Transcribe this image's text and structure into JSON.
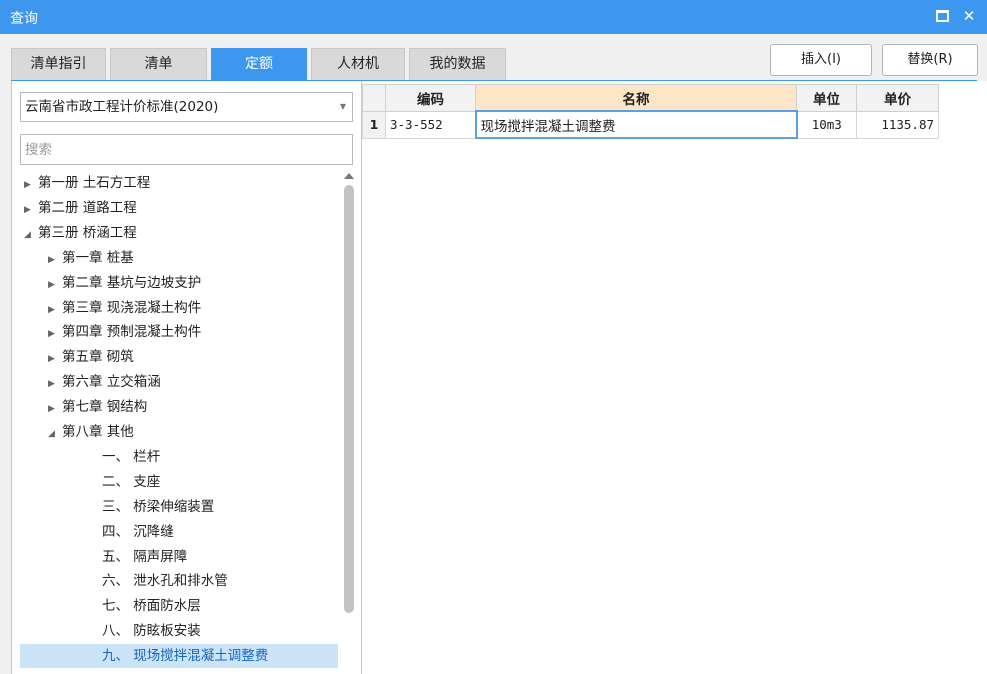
{
  "window": {
    "title": "查询"
  },
  "tabs": [
    "清单指引",
    "清单",
    "定额",
    "人材机",
    "我的数据"
  ],
  "active_tab": "定额",
  "buttons": {
    "insert": "插入(I)",
    "replace": "替换(R)"
  },
  "library_select": {
    "value": "云南省市政工程计价标准(2020)"
  },
  "search": {
    "placeholder": "搜索"
  },
  "tree": [
    {
      "label": "第一册 土石方工程",
      "state": "collapsed",
      "level": 0
    },
    {
      "label": "第二册 道路工程",
      "state": "collapsed",
      "level": 0
    },
    {
      "label": "第三册 桥涵工程",
      "state": "expanded",
      "level": 0
    },
    {
      "label": "第一章 桩基",
      "state": "collapsed",
      "level": 1
    },
    {
      "label": "第二章 基坑与边坡支护",
      "state": "collapsed",
      "level": 1
    },
    {
      "label": "第三章 现浇混凝土构件",
      "state": "collapsed",
      "level": 1
    },
    {
      "label": "第四章 预制混凝土构件",
      "state": "collapsed",
      "level": 1
    },
    {
      "label": "第五章 砌筑",
      "state": "collapsed",
      "level": 1
    },
    {
      "label": "第六章 立交箱涵",
      "state": "collapsed",
      "level": 1
    },
    {
      "label": "第七章 钢结构",
      "state": "collapsed",
      "level": 1
    },
    {
      "label": "第八章 其他",
      "state": "expanded",
      "level": 1
    },
    {
      "label": "一、 栏杆",
      "state": "leaf",
      "level": 2
    },
    {
      "label": "二、 支座",
      "state": "leaf",
      "level": 2
    },
    {
      "label": "三、 桥梁伸缩装置",
      "state": "leaf",
      "level": 2
    },
    {
      "label": "四、 沉降缝",
      "state": "leaf",
      "level": 2
    },
    {
      "label": "五、 隔声屏障",
      "state": "leaf",
      "level": 2
    },
    {
      "label": "六、 泄水孔和排水管",
      "state": "leaf",
      "level": 2
    },
    {
      "label": "七、 桥面防水层",
      "state": "leaf",
      "level": 2
    },
    {
      "label": "八、 防眩板安装",
      "state": "leaf",
      "level": 2
    },
    {
      "label": "九、 现场搅拌混凝土调整费",
      "state": "leaf",
      "level": 2,
      "selected": true
    }
  ],
  "table": {
    "columns": [
      "编码",
      "名称",
      "单位",
      "单价"
    ],
    "rows": [
      {
        "num": "1",
        "code": "3-3-552",
        "name": "现场搅拌混凝土调整费",
        "unit": "10m3",
        "price": "1135.87"
      }
    ]
  },
  "colors": {
    "accent": "#3e97ef",
    "selected_bg": "#cce4f7",
    "header_highlight": "#fde6c8"
  }
}
